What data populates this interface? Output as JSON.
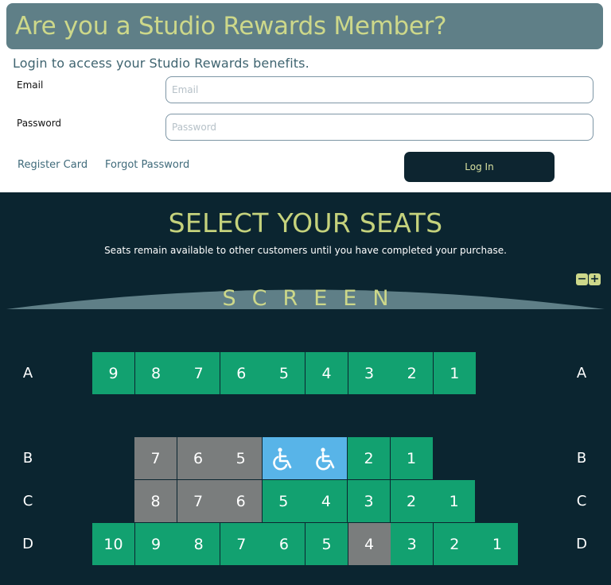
{
  "rewards": {
    "heading": "Are you a Studio Rewards Member?",
    "subtitle": "Login to access your Studio Rewards benefits.",
    "email_label": "Email",
    "email_placeholder": "Email",
    "email_value": "",
    "password_label": "Password",
    "password_placeholder": "Password",
    "password_value": "",
    "register_link": "Register Card",
    "forgot_link": "Forgot Password",
    "login_button": "Log In"
  },
  "seating": {
    "title": "SELECT YOUR SEATS",
    "subtitle": "Seats remain available to other customers until you have completed your purchase.",
    "screen_label": "SCREEN",
    "zoom_out_label": "−",
    "zoom_in_label": "+",
    "rows": [
      {
        "label": "A",
        "seats": [
          {
            "number": "9",
            "status": "available"
          },
          {
            "number": "8",
            "status": "available"
          },
          {
            "number": "7",
            "status": "available"
          },
          {
            "number": "6",
            "status": "available"
          },
          {
            "number": "5",
            "status": "available"
          },
          {
            "number": "4",
            "status": "available"
          },
          {
            "number": "3",
            "status": "available"
          },
          {
            "number": "2",
            "status": "available"
          },
          {
            "number": "1",
            "status": "available"
          }
        ]
      },
      {
        "label": "B",
        "seats": [
          {
            "number": "7",
            "status": "taken"
          },
          {
            "number": "6",
            "status": "taken"
          },
          {
            "number": "5",
            "status": "taken"
          },
          {
            "number": "",
            "status": "wheelchair",
            "icon": "wheelchair-icon"
          },
          {
            "number": "",
            "status": "wheelchair",
            "icon": "wheelchair-icon"
          },
          {
            "number": "2",
            "status": "available"
          },
          {
            "number": "1",
            "status": "available"
          }
        ]
      },
      {
        "label": "C",
        "seats": [
          {
            "number": "8",
            "status": "taken"
          },
          {
            "number": "7",
            "status": "taken"
          },
          {
            "number": "6",
            "status": "taken"
          },
          {
            "number": "5",
            "status": "available"
          },
          {
            "number": "4",
            "status": "available"
          },
          {
            "number": "3",
            "status": "available"
          },
          {
            "number": "2",
            "status": "available"
          },
          {
            "number": "1",
            "status": "available"
          }
        ]
      },
      {
        "label": "D",
        "seats": [
          {
            "number": "10",
            "status": "available"
          },
          {
            "number": "9",
            "status": "available"
          },
          {
            "number": "8",
            "status": "available"
          },
          {
            "number": "7",
            "status": "available"
          },
          {
            "number": "6",
            "status": "available"
          },
          {
            "number": "5",
            "status": "available"
          },
          {
            "number": "4",
            "status": "taken"
          },
          {
            "number": "3",
            "status": "available"
          },
          {
            "number": "2",
            "status": "available"
          },
          {
            "number": "1",
            "status": "available"
          }
        ]
      }
    ]
  },
  "colors": {
    "banner": "#5f7f87",
    "accent": "#cdd88a",
    "dark_background": "#0b2530",
    "seat_available": "#12a170",
    "seat_taken": "#7a7d7d",
    "seat_wheelchair": "#58b4e8"
  }
}
